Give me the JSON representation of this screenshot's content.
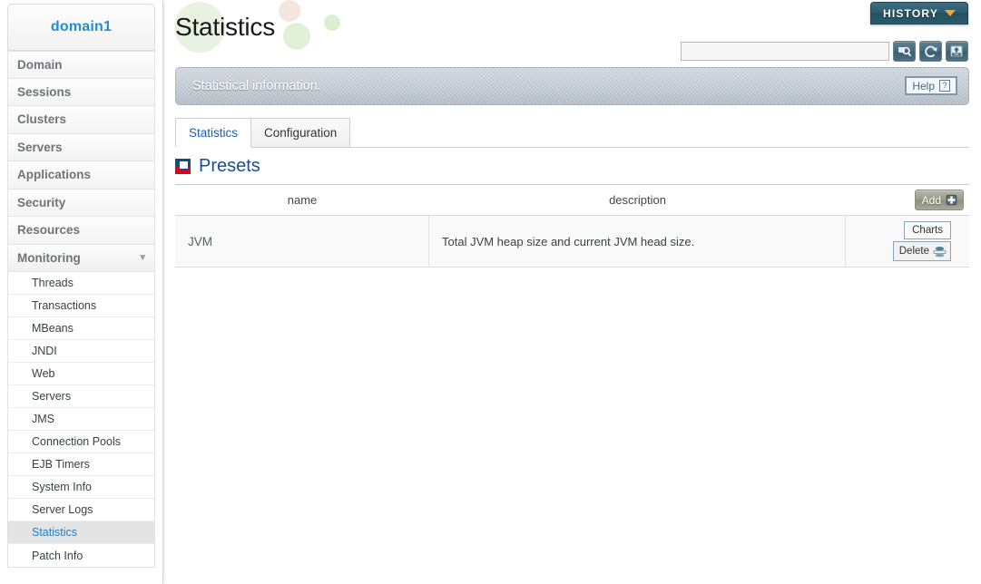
{
  "sidebar": {
    "brand": "domain1",
    "main_items": [
      {
        "label": "Domain"
      },
      {
        "label": "Sessions"
      },
      {
        "label": "Clusters"
      },
      {
        "label": "Servers"
      },
      {
        "label": "Applications"
      },
      {
        "label": "Security"
      },
      {
        "label": "Resources"
      },
      {
        "label": "Monitoring",
        "expanded": true,
        "chevron": "chevron-down-icon"
      }
    ],
    "sub_items": [
      {
        "label": "Threads"
      },
      {
        "label": "Transactions"
      },
      {
        "label": "MBeans"
      },
      {
        "label": "JNDI"
      },
      {
        "label": "Web"
      },
      {
        "label": "Servers"
      },
      {
        "label": "JMS"
      },
      {
        "label": "Connection Pools"
      },
      {
        "label": "EJB Timers"
      },
      {
        "label": "System Info"
      },
      {
        "label": "Server Logs"
      },
      {
        "label": "Statistics",
        "selected": true
      },
      {
        "label": "Patch Info"
      }
    ]
  },
  "header": {
    "title": "Statistics",
    "history_label": "HISTORY",
    "history_chevron": "chevron-down-icon"
  },
  "toolbar": {
    "search_value": "",
    "search_placeholder": "",
    "buttons": [
      {
        "name": "search-icon",
        "title": "Search"
      },
      {
        "name": "refresh-icon",
        "title": "Refresh"
      },
      {
        "name": "xml-export-icon",
        "title": "Export XML"
      }
    ]
  },
  "info_band": {
    "text": "Statistical information.",
    "help_label": "Help",
    "help_glyph": "?"
  },
  "tabs": [
    {
      "label": "Statistics",
      "active": true
    },
    {
      "label": "Configuration",
      "active": false
    }
  ],
  "presets": {
    "section_title": "Presets",
    "section_icon": "presets-icon",
    "columns": {
      "name": "name",
      "description": "description"
    },
    "add_label": "Add",
    "add_icon": "add-plus-icon",
    "rows": [
      {
        "name": "JVM",
        "description": "Total JVM heap size and current JVM head size.",
        "charts_label": "Charts",
        "delete_label": "Delete",
        "delete_icon": "delete-icon"
      }
    ]
  },
  "colors": {
    "brand_blue": "#1f8fd4",
    "presets_title": "#1c4f8f",
    "accent_red": "#e3001b",
    "accent_navy": "#0b4e8a",
    "history_bg": "#2d5c6d",
    "history_chevron": "#f4a72a",
    "info_band_bg": "#b9c2cc",
    "selected_item_bg": "#e4e4e4",
    "selected_item_text": "#1f7fc4"
  }
}
